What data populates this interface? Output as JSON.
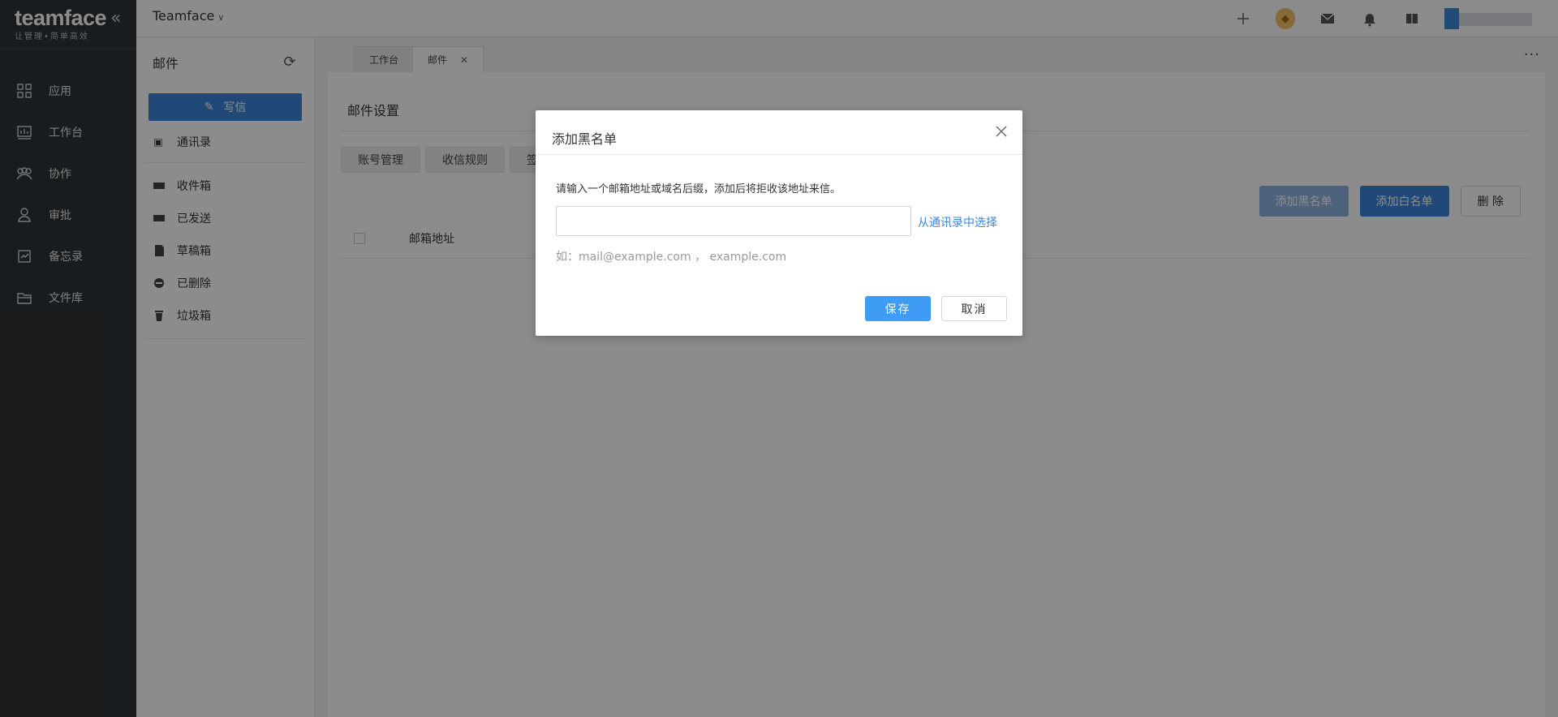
{
  "brand": {
    "logo": "teamface",
    "slogan": "让管理•简单高效"
  },
  "leftnav": {
    "items": [
      {
        "label": "应用",
        "icon": "app-grid-icon"
      },
      {
        "label": "工作台",
        "icon": "dashboard-icon"
      },
      {
        "label": "协作",
        "icon": "team-icon"
      },
      {
        "label": "审批",
        "icon": "approval-icon"
      },
      {
        "label": "备忘录",
        "icon": "memo-icon"
      },
      {
        "label": "文件库",
        "icon": "folder-icon"
      }
    ]
  },
  "header": {
    "workspace": "Teamface"
  },
  "mail_sidebar": {
    "title": "邮件",
    "compose_label": "写信",
    "contacts_label": "通讯录",
    "folders": [
      {
        "label": "收件箱",
        "icon": "inbox-icon"
      },
      {
        "label": "已发送",
        "icon": "sent-icon"
      },
      {
        "label": "草稿箱",
        "icon": "draft-icon"
      },
      {
        "label": "已删除",
        "icon": "deleted-icon"
      },
      {
        "label": "垃圾箱",
        "icon": "trash-icon"
      }
    ]
  },
  "tabs": [
    {
      "label": "工作台"
    },
    {
      "label": "邮件"
    }
  ],
  "settings": {
    "title": "邮件设置",
    "tabs": [
      "账号管理",
      "收信规则",
      "签"
    ],
    "actions": {
      "add_blacklist": "添加黑名单",
      "add_whitelist": "添加白名单",
      "delete": "删 除"
    },
    "table": {
      "columns": [
        "邮箱地址"
      ]
    }
  },
  "dialog": {
    "title": "添加黑名单",
    "description": "请输入一个邮箱地址或域名后缀，添加后将拒收该地址来信。",
    "input_value": "",
    "link": "从通讯录中选择",
    "hint": "如：mail@example.com ， example.com",
    "save": "保存",
    "cancel": "取消"
  },
  "colors": {
    "primary": "#3b86d9",
    "save_button": "#3f9cf5",
    "nav_bg": "#2f3337"
  }
}
